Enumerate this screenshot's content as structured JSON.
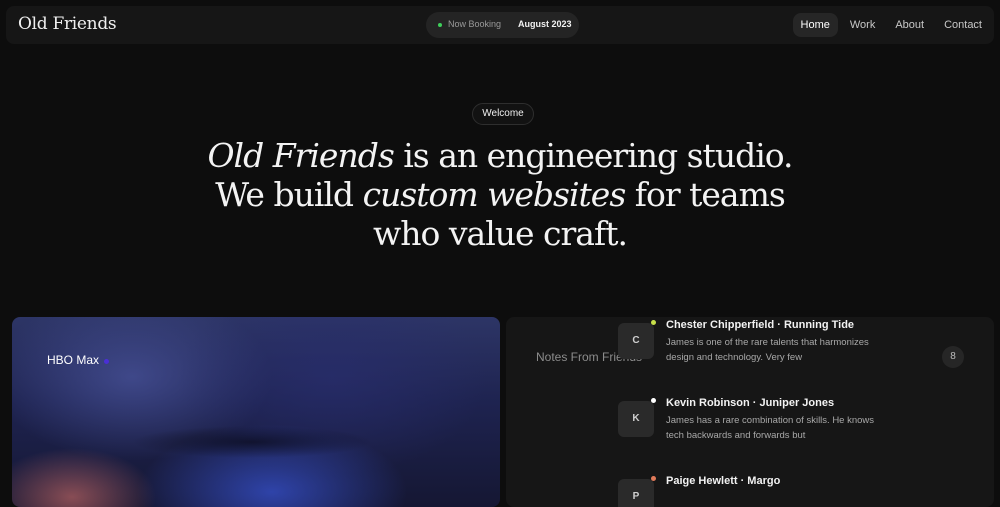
{
  "brand": "Old Friends",
  "booking": {
    "status": "Now Booking",
    "month": "August 2023",
    "dot_color": "#3ecf5a"
  },
  "nav": [
    {
      "label": "Home",
      "active": true
    },
    {
      "label": "Work",
      "active": false
    },
    {
      "label": "About",
      "active": false
    },
    {
      "label": "Contact",
      "active": false
    }
  ],
  "hero": {
    "badge": "Welcome",
    "line1_em": "Old Friends",
    "line1_rest": " is an engineering studio.",
    "line2_pre": "We build ",
    "line2_em": "custom websites",
    "line2_post": " for teams",
    "line3": "who value craft."
  },
  "showcase": {
    "client": "HBO Max",
    "dot_color": "#4a2fd6"
  },
  "notes": {
    "title": "Notes From Friends",
    "count": "8",
    "items": [
      {
        "initial": "C",
        "badge_color": "#c8e04a",
        "name": "Chester Chipperfield · Running Tide",
        "quote": "James is one of the rare talents that harmonizes design and technology. Very few"
      },
      {
        "initial": "K",
        "badge_color": "#ffffff",
        "name": "Kevin Robinson · Juniper Jones",
        "quote": "James has a rare combination of skills. He knows tech backwards and forwards but"
      },
      {
        "initial": "P",
        "badge_color": "#e07a5a",
        "name": "Paige Hewlett · Margo",
        "quote": ""
      }
    ]
  }
}
